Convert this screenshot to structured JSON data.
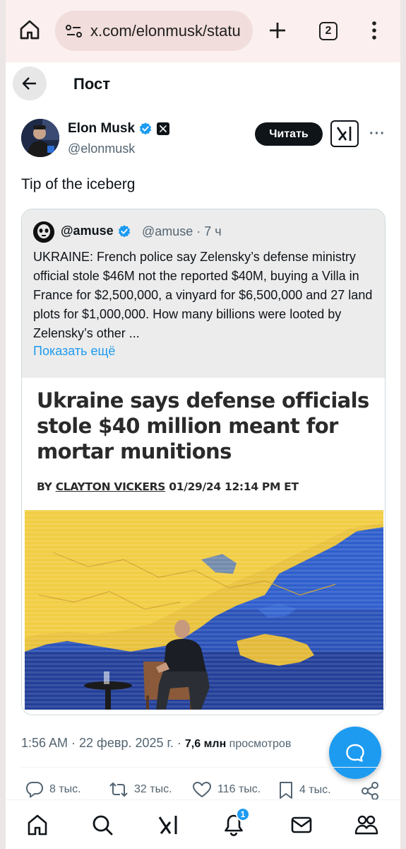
{
  "browser": {
    "url": "x.com/elonmusk/statu",
    "tab_count": "2"
  },
  "header": {
    "title": "Пост"
  },
  "tweet": {
    "author_name": "Elon Musk",
    "author_handle": "@elonmusk",
    "read_button": "Читать",
    "text": "Tip of the iceberg",
    "time": "1:56 AM · 22 февр. 2025 г. · ",
    "views_count": "7,6 млн",
    "views_label": " просмотров"
  },
  "quote": {
    "name": "@amuse",
    "handle_time": "@amuse · 7 ч",
    "body": "UKRAINE: French police say Zelensky’s defense ministry official stole $46M not the reported $40M, buying a Villa in France for $2,500,000, a vinyard for $6,500,000 and 27 land plots for $1,000,000. How many billions were looted by Zelensky’s other ...",
    "show_more": "Показать ещё",
    "article": {
      "headline": "Ukraine says defense officials stole $40 million meant for mortar munitions",
      "by": "BY ",
      "author": "CLAYTON VICKERS",
      "date": " 01/29/24 12:14 PM ET"
    }
  },
  "actions": {
    "replies": "8 тыс.",
    "reposts": "32 тыс.",
    "likes": "116 тыс.",
    "bookmarks": "4 тыс."
  },
  "nav": {
    "notification_count": "1"
  },
  "colors": {
    "accent": "#1d9bf0",
    "text": "#0f1419",
    "secondary": "#536471",
    "browser_bar": "#fbf0ef"
  }
}
